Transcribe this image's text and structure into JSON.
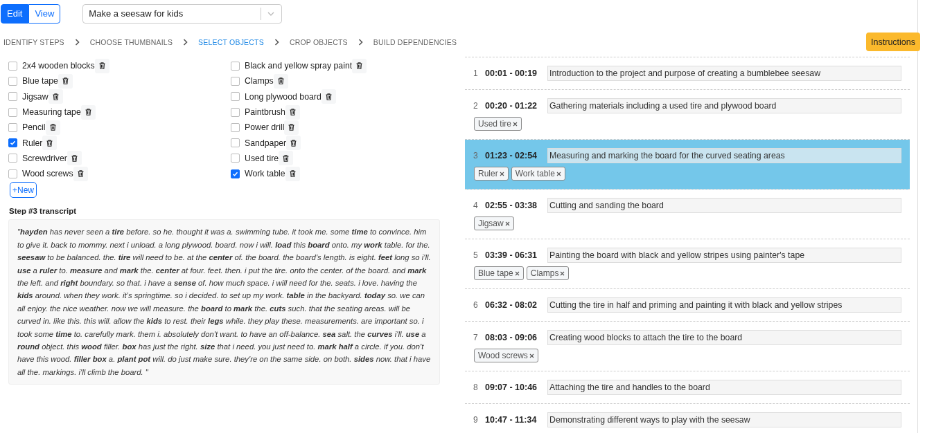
{
  "mode_toggle": [
    {
      "label": "Edit",
      "selected": true
    },
    {
      "label": "View",
      "selected": false
    }
  ],
  "project_select": {
    "value": "Make a seesaw for kids"
  },
  "stepper": [
    {
      "label": "IDENTIFY STEPS",
      "selected": false
    },
    {
      "label": "CHOOSE THUMBNAILS",
      "selected": false
    },
    {
      "label": "SELECT OBJECTS",
      "selected": true
    },
    {
      "label": "CROP OBJECTS",
      "selected": false
    },
    {
      "label": "BUILD DEPENDENCIES",
      "selected": false
    }
  ],
  "instructions_button": "Instructions",
  "objects": [
    {
      "label": "2x4 wooden blocks",
      "checked": false
    },
    {
      "label": "Blue tape",
      "checked": false
    },
    {
      "label": "Jigsaw",
      "checked": false
    },
    {
      "label": "Measuring tape",
      "checked": false
    },
    {
      "label": "Pencil",
      "checked": false
    },
    {
      "label": "Ruler",
      "checked": true
    },
    {
      "label": "Screwdriver",
      "checked": false
    },
    {
      "label": "Wood screws",
      "checked": false
    },
    {
      "label": "Black and yellow spray paint",
      "checked": false
    },
    {
      "label": "Clamps",
      "checked": false
    },
    {
      "label": "Long plywood board",
      "checked": false
    },
    {
      "label": "Paintbrush",
      "checked": false
    },
    {
      "label": "Power drill",
      "checked": false
    },
    {
      "label": "Sandpaper",
      "checked": false
    },
    {
      "label": "Used tire",
      "checked": false
    },
    {
      "label": "Work table",
      "checked": true
    }
  ],
  "new_button": "+New",
  "transcript": {
    "title": "Step #3 transcript",
    "text": "\"**hayden** has never seen a **tire** before. so he. thought it was a. swimming tube. it took me. some **time** to convince. him to give it. back to mommy. next i unload. a long plywood. board. now i will. **load** this **board** onto. my **work** table. for the. **seesaw** to be balanced. the. **tire** will need to be. at the **center** of. the board. the board's length. is eight. **feet** long so i'll. **use** a **ruler** to. **measure** and **mark** the. **center** at four. feet. then. i put the tire. onto the center. of the board. and **mark** the left. and **right** boundary. so that. i have a **sense** of. how much space. i will need for the. seats. i love. having the **kids** around. when they work. it’s springtime. so i decided. to set up my work. **table** in the backyard. **today** so. we can all enjoy. the nice weather. now we will measure. the **board** to **mark** the. **cuts** such. that the seating areas. will be curved in. like this. this will. allow the **kids** to rest. their **legs** while. they play these. measurements. are important so. i took some **time** to. carefully mark. them i. absolutely don't want. to have an off-balance. **sea** salt. the **curves** i'll. **use** a **round** object. this **wood** filler. **box** has just the right. **size** that i need. you just need to. **mark half** a circle. if you. don't have this wood. **filler box** a. **plant pot** will. do just make sure. they're on the same side. on both. **sides** now. that i have all the. markings. i'll climb the board. \""
  },
  "steps": [
    {
      "number": "1",
      "time": "00:01 - 00:19",
      "description": "Introduction to the project and purpose of creating a bumblebee seesaw",
      "selected": false
    },
    {
      "number": "2",
      "time": "00:20 - 01:22",
      "description": "Gathering materials including a used tire and plywood board",
      "selected": false,
      "tags": [
        "Used tire"
      ]
    },
    {
      "number": "3",
      "time": "01:23 - 02:54",
      "description": "Measuring and marking the board for the curved seating areas",
      "selected": true,
      "tags": [
        "Ruler",
        "Work table"
      ]
    },
    {
      "number": "4",
      "time": "02:55 - 03:38",
      "description": "Cutting and sanding the board",
      "selected": false,
      "tags": [
        "Jigsaw"
      ]
    },
    {
      "number": "5",
      "time": "03:39 - 06:31",
      "description": "Painting the board with black and yellow stripes using painter's tape",
      "selected": false,
      "tags": [
        "Blue tape",
        "Clamps"
      ]
    },
    {
      "number": "6",
      "time": "06:32 - 08:02",
      "description": "Cutting the tire in half and priming and painting it with black and yellow stripes",
      "selected": false
    },
    {
      "number": "7",
      "time": "08:03 - 09:06",
      "description": "Creating wood blocks to attach the tire to the board",
      "selected": false,
      "tags": [
        "Wood screws"
      ]
    },
    {
      "number": "8",
      "time": "09:07 - 10:46",
      "description": "Attaching the tire and handles to the board",
      "selected": false
    },
    {
      "number": "9",
      "time": "10:47 - 11:34",
      "description": "Demonstrating different ways to play with the seesaw",
      "selected": false
    }
  ]
}
